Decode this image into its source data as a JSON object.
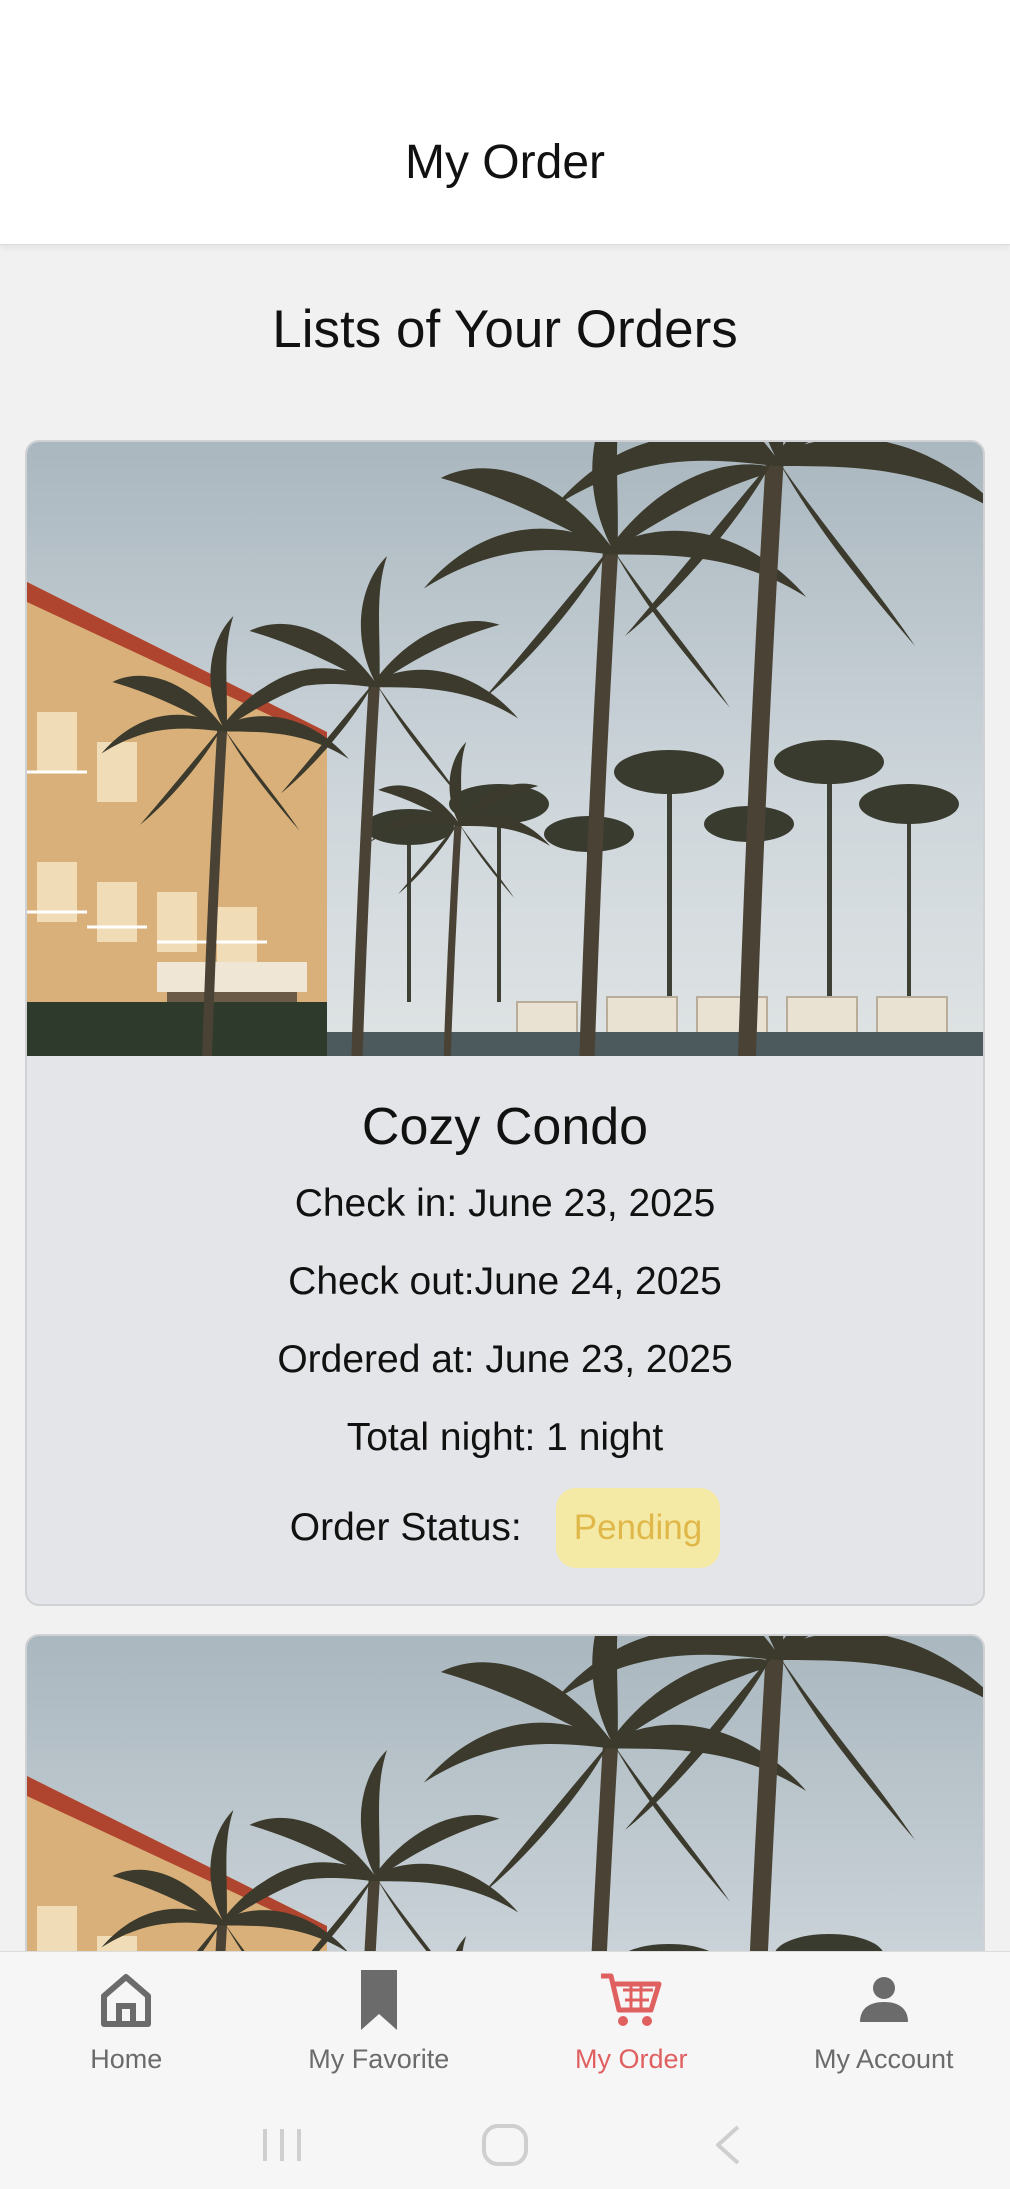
{
  "header": {
    "title": "My Order"
  },
  "page": {
    "list_title": "Lists of Your Orders"
  },
  "orders": [
    {
      "name": "Cozy Condo",
      "check_in": "Check in: June 23, 2025",
      "check_out": "Check out:June 24, 2025",
      "ordered_at": "Ordered at: June 23, 2025",
      "total_night": "Total night: 1 night",
      "status_label": "Order Status:",
      "status": "Pending",
      "image": "resort-palm-trees-photo"
    },
    {
      "image": "resort-palm-trees-photo"
    }
  ],
  "bottom_nav": {
    "items": [
      {
        "label": "Home",
        "icon": "home-icon",
        "active": false
      },
      {
        "label": "My Favorite",
        "icon": "bookmark-icon",
        "active": false
      },
      {
        "label": "My Order",
        "icon": "cart-icon",
        "active": true
      },
      {
        "label": "My Account",
        "icon": "person-icon",
        "active": false
      }
    ]
  },
  "colors": {
    "accent": "#e06060",
    "pending_badge_bg": "#f5e9a6",
    "pending_badge_text": "#e0b84a",
    "card_bg": "#e4e5e8",
    "page_bg": "#f1f1f1"
  }
}
